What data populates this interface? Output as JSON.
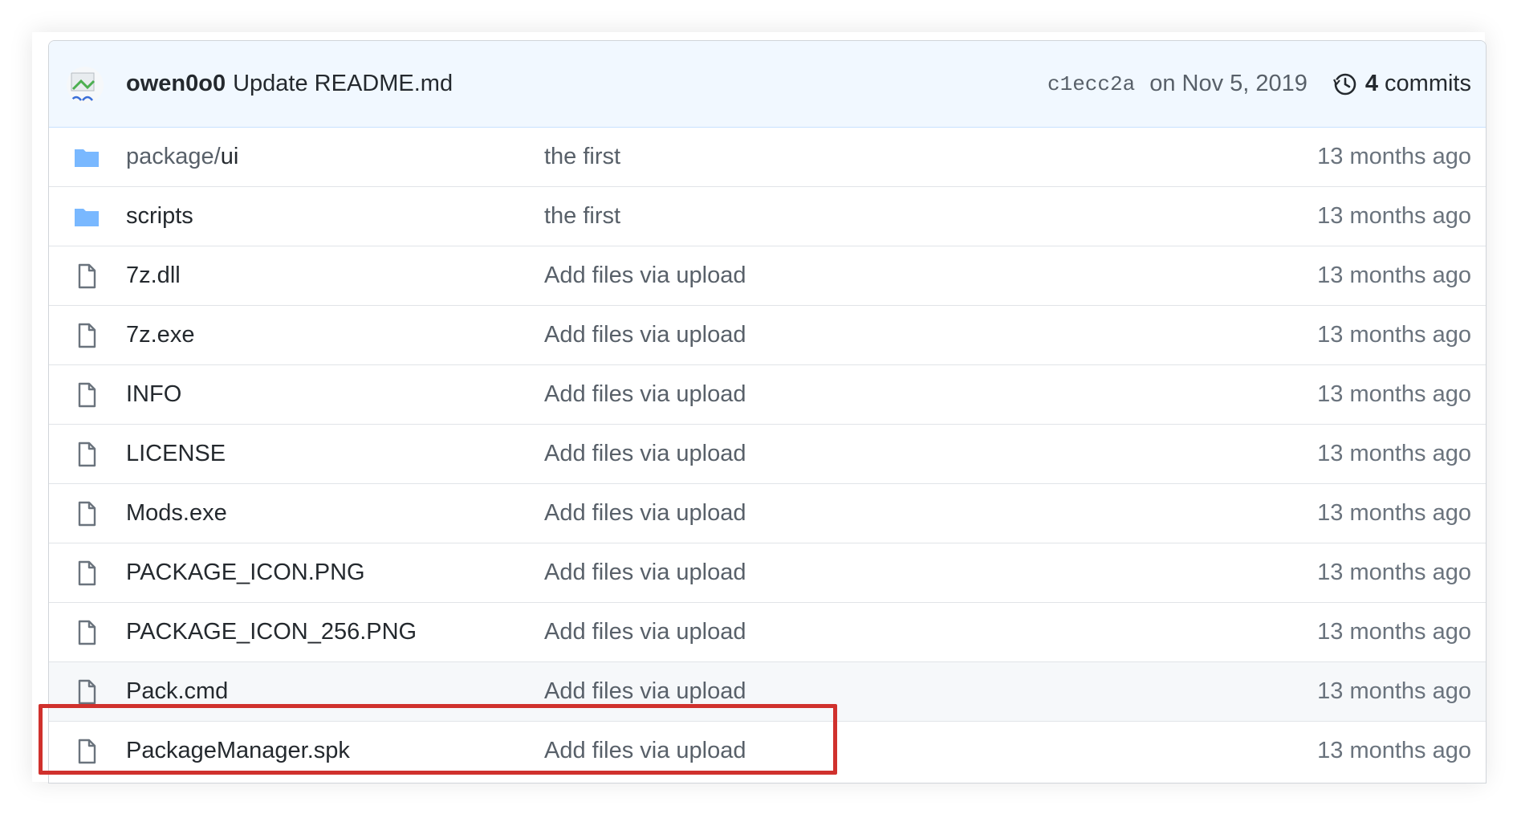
{
  "commit": {
    "author": "owen0o0",
    "message": "Update README.md",
    "sha": "c1ecc2a",
    "date": "on Nov 5, 2019",
    "count": "4",
    "count_label": "commits"
  },
  "files": [
    {
      "type": "folder",
      "path": "package/",
      "name": "ui",
      "message": "the first",
      "age": "13 months ago"
    },
    {
      "type": "folder",
      "path": "",
      "name": "scripts",
      "message": "the first",
      "age": "13 months ago"
    },
    {
      "type": "file",
      "path": "",
      "name": "7z.dll",
      "message": "Add files via upload",
      "age": "13 months ago"
    },
    {
      "type": "file",
      "path": "",
      "name": "7z.exe",
      "message": "Add files via upload",
      "age": "13 months ago"
    },
    {
      "type": "file",
      "path": "",
      "name": "INFO",
      "message": "Add files via upload",
      "age": "13 months ago"
    },
    {
      "type": "file",
      "path": "",
      "name": "LICENSE",
      "message": "Add files via upload",
      "age": "13 months ago"
    },
    {
      "type": "file",
      "path": "",
      "name": "Mods.exe",
      "message": "Add files via upload",
      "age": "13 months ago"
    },
    {
      "type": "file",
      "path": "",
      "name": "PACKAGE_ICON.PNG",
      "message": "Add files via upload",
      "age": "13 months ago"
    },
    {
      "type": "file",
      "path": "",
      "name": "PACKAGE_ICON_256.PNG",
      "message": "Add files via upload",
      "age": "13 months ago"
    },
    {
      "type": "file",
      "path": "",
      "name": "Pack.cmd",
      "message": "Add files via upload",
      "age": "13 months ago"
    },
    {
      "type": "file",
      "path": "",
      "name": "PackageManager.spk",
      "message": "Add files via upload",
      "age": "13 months ago"
    }
  ],
  "colors": {
    "folder": "#79b8ff",
    "highlight": "#d0312d",
    "header_bg": "#f1f8ff"
  },
  "icons": {
    "folder": "folder-icon",
    "file": "file-icon",
    "history": "history-icon"
  }
}
